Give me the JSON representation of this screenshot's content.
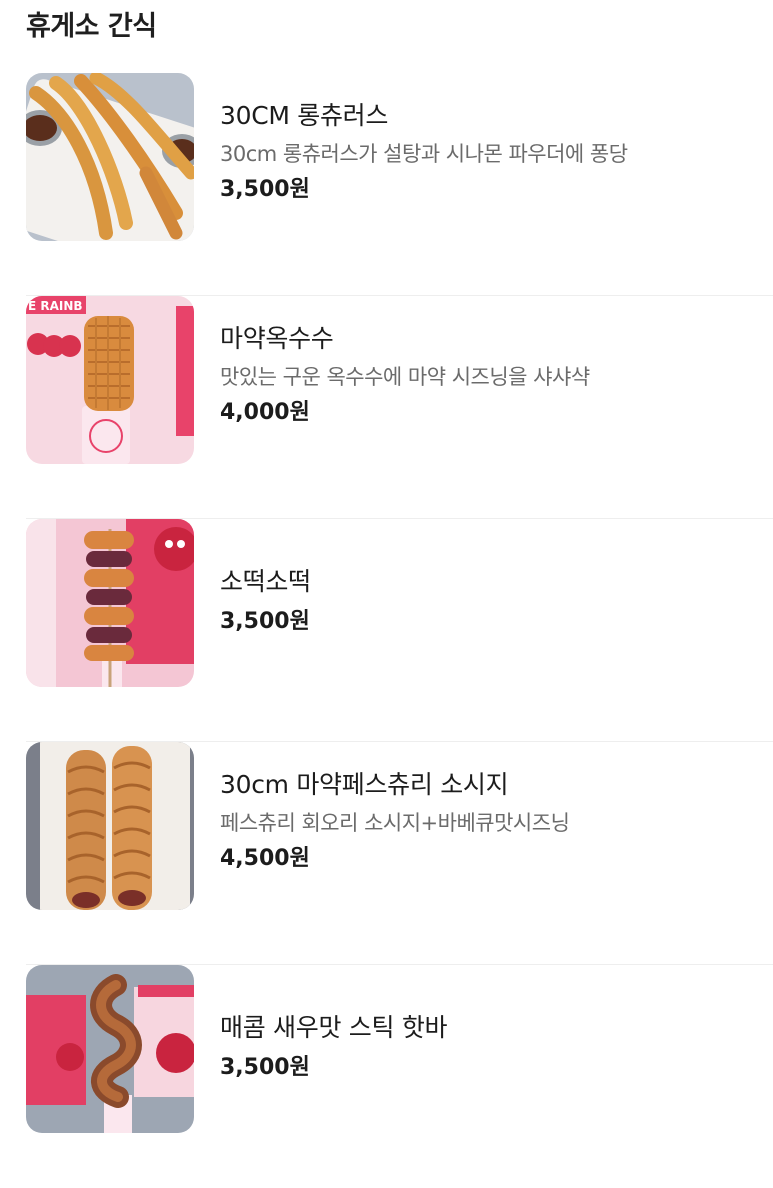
{
  "section": {
    "title": "휴게소 간식"
  },
  "menu": {
    "items": [
      {
        "name": "30CM 롱츄러스",
        "description": "30cm 롱츄러스가 설탕과 시나몬 파우더에 퐁당",
        "price": "3,500원",
        "image": "churros-photo"
      },
      {
        "name": "마약옥수수",
        "description": "맛있는 구운 옥수수에 마약 시즈닝을 샤샤샥",
        "price": "4,000원",
        "image": "corn-photo"
      },
      {
        "name": "소떡소떡",
        "price": "3,500원",
        "image": "sotteok-photo"
      },
      {
        "name": "30cm 마약페스츄리 소시지",
        "description": "페스츄리 회오리 소시지+바베큐맛시즈닝",
        "price": "4,500원",
        "image": "pastry-sausage-photo"
      },
      {
        "name": "매콤 새우맛 스틱 핫바",
        "price": "3,500원",
        "image": "shrimp-hotbar-photo"
      }
    ]
  },
  "colors": {
    "text": "#1c1c1c",
    "description": "#6b6b6b",
    "divider": "#eeeeee",
    "brand_pink": "#e8436a"
  }
}
